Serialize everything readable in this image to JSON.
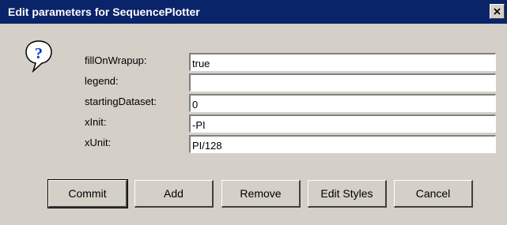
{
  "window": {
    "title": "Edit parameters for SequencePlotter",
    "close_glyph": "×"
  },
  "icon": "question-mark-icon",
  "fields": [
    {
      "label": "fillOnWrapup:",
      "value": "true"
    },
    {
      "label": "legend:",
      "value": ""
    },
    {
      "label": "startingDataset:",
      "value": "0"
    },
    {
      "label": "xInit:",
      "value": "-PI"
    },
    {
      "label": "xUnit:",
      "value": "PI/128"
    }
  ],
  "buttons": {
    "commit": "Commit",
    "add": "Add",
    "remove": "Remove",
    "edit_styles": "Edit Styles",
    "cancel": "Cancel"
  },
  "colors": {
    "titlebar": "#0a246a",
    "window_bg": "#d4d0c8"
  }
}
